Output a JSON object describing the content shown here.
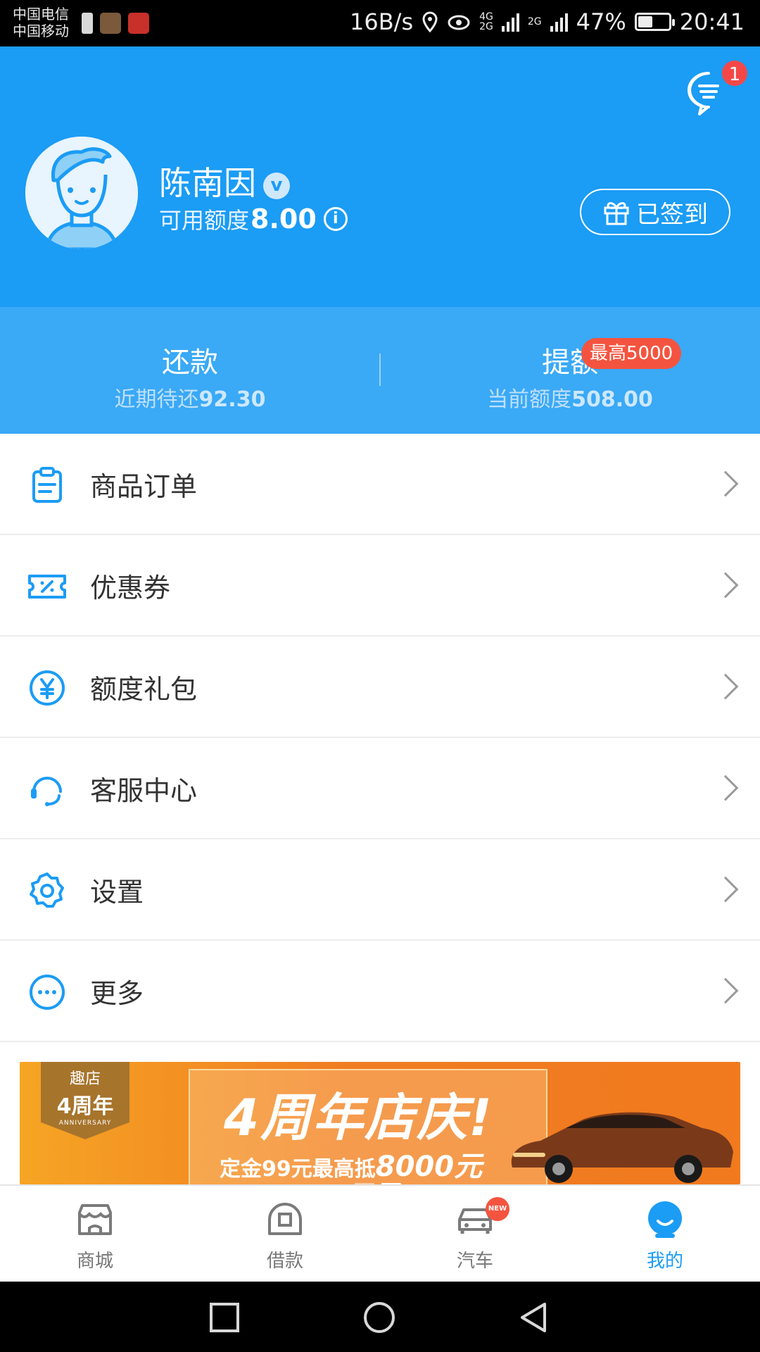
{
  "status_bar": {
    "carrier_1": "中国电信",
    "carrier_2": "中国移动",
    "net_speed": "16B/s",
    "signal_label_1": "4G",
    "signal_label_2": "2G",
    "battery_percent": "47%",
    "battery_level": 0.47,
    "time": "20:41"
  },
  "header": {
    "message_badge": "1",
    "username": "陈南因",
    "verified_mark": "v",
    "credit_label": "可用额度",
    "credit_value": "8.00",
    "info_glyph": "i",
    "signin_label": "已签到",
    "brand_color": "#1b9cf5"
  },
  "band": {
    "repay_title": "还款",
    "repay_sub_label": "近期待还",
    "repay_sub_value": "92.30",
    "raise_title": "提额",
    "raise_badge": "最高5000",
    "raise_sub_label": "当前额度",
    "raise_sub_value": "508.00"
  },
  "menu": {
    "items": [
      {
        "label": "商品订单",
        "icon": "clipboard-icon"
      },
      {
        "label": "优惠券",
        "icon": "coupon-icon"
      },
      {
        "label": "额度礼包",
        "icon": "yen-coin-icon"
      },
      {
        "label": "客服中心",
        "icon": "headset-icon"
      },
      {
        "label": "设置",
        "icon": "gear-icon"
      },
      {
        "label": "更多",
        "icon": "more-dots-icon"
      }
    ]
  },
  "banner": {
    "badge_line1": "趣店",
    "badge_line2": "4周年",
    "badge_line3": "ANNIVERSARY",
    "title": "4周年店庆!",
    "sub_prefix": "定金99元最高抵",
    "sub_amount": "8000元"
  },
  "tabbar": {
    "tabs": [
      {
        "label": "商城",
        "icon": "store-icon"
      },
      {
        "label": "借款",
        "icon": "loan-icon"
      },
      {
        "label": "汽车",
        "icon": "car-icon",
        "badge": "NEW"
      },
      {
        "label": "我的",
        "icon": "profile-icon",
        "active": true
      }
    ]
  }
}
